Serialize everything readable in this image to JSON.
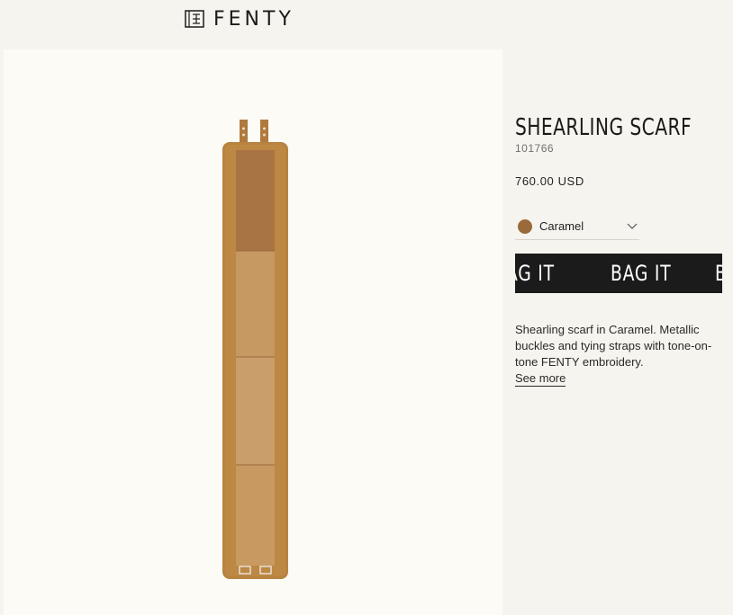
{
  "header": {
    "brand": "FENTY",
    "logo_icon": "fenty-monogram-icon"
  },
  "product": {
    "title": "SHEARLING SCARF",
    "sku": "101766",
    "price": "760.00 USD",
    "color": {
      "name": "Caramel",
      "swatch": "#9a6a3a"
    },
    "cta_text": [
      "AG IT",
      "BAG IT",
      "BAG IT"
    ],
    "description": "Shearling scarf in Caramel. Metallic buckles and tying straps with tone-on-tone FENTY embroidery.",
    "see_more": "See more",
    "image_alt_icon": "shearling-scarf-image"
  },
  "colors": {
    "page_bg": "#f6f4ee",
    "panel_bg": "#fcfbf6",
    "button_bg": "#1b1b1b",
    "shearling": "#b8823f",
    "suede": "#c89b67"
  }
}
